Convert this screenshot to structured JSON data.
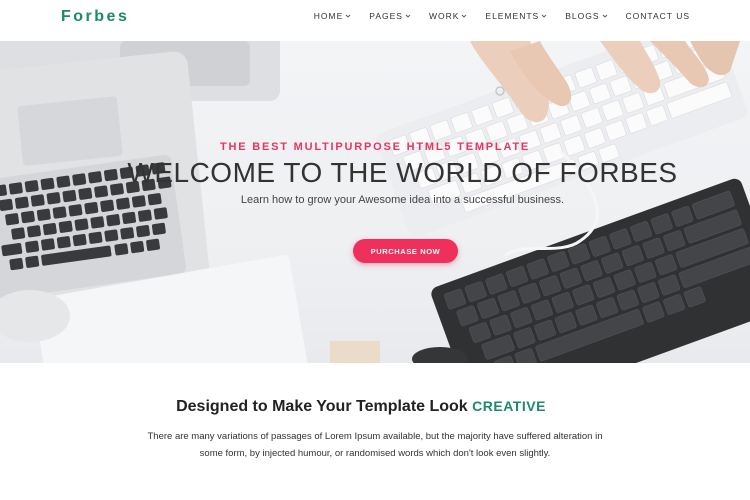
{
  "header": {
    "logo": "Forbes",
    "nav": [
      {
        "label": "HOME",
        "has_dropdown": true
      },
      {
        "label": "PAGES",
        "has_dropdown": true
      },
      {
        "label": "WORK",
        "has_dropdown": true
      },
      {
        "label": "ELEMENTS",
        "has_dropdown": true
      },
      {
        "label": "BLOGS",
        "has_dropdown": true
      },
      {
        "label": "CONTACT US",
        "has_dropdown": false
      }
    ]
  },
  "hero": {
    "tagline": "THE BEST MULTIPURPOSE HTML5 TEMPLATE",
    "title": "WELCOME TO THE WORLD OF FORBES",
    "subtitle": "Learn how to grow your Awesome idea into a successful business.",
    "cta_label": "PURCHASE NOW"
  },
  "section": {
    "title_main": "Designed to Make Your Template Look",
    "title_accent": "CREATIVE",
    "text": "There are many variations of passages of Lorem Ipsum available, but the majority have suffered alteration in some form, by injected humour, or randomised words which don't look even slightly."
  },
  "colors": {
    "brand": "#1d8a6a",
    "accent": "#f0305c",
    "tagline": "#e8355f"
  }
}
